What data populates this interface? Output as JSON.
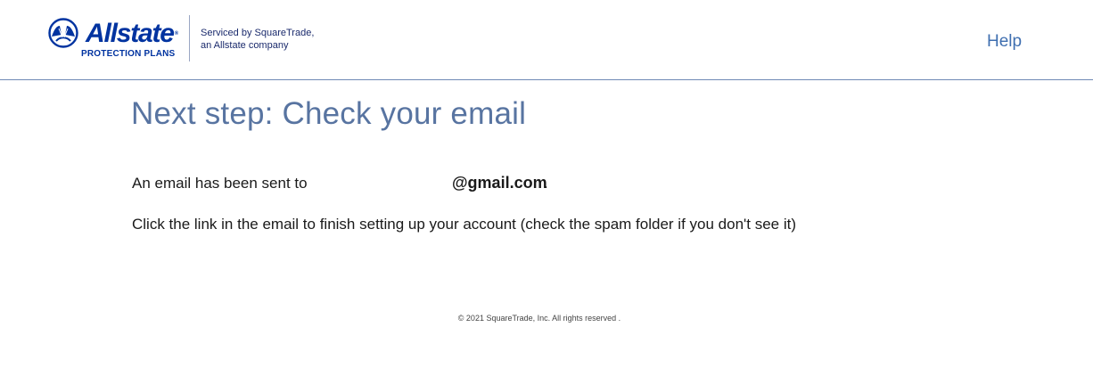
{
  "header": {
    "logo": {
      "icon": "allstate-hands-icon",
      "wordmark": "Allstate",
      "registered": "®",
      "subtitle": "PROTECTION PLANS"
    },
    "serviced_by": {
      "line1": "Serviced by SquareTrade,",
      "line2": "an Allstate company"
    },
    "help_label": "Help"
  },
  "main": {
    "title": "Next step: Check your email",
    "sent_text": "An email has been sent to",
    "email_domain": "@gmail.com",
    "period": ".",
    "instruction": "Click the link in the email to finish setting up your account (check the spam folder if you don't see it)"
  },
  "footer": {
    "copyright": "© 2021 SquareTrade, Inc. All rights reserved ."
  },
  "colors": {
    "brand_blue": "#0033a0",
    "title_blue": "#5874a1",
    "link_blue": "#3f6fb0",
    "header_rule": "#6f89b5"
  }
}
